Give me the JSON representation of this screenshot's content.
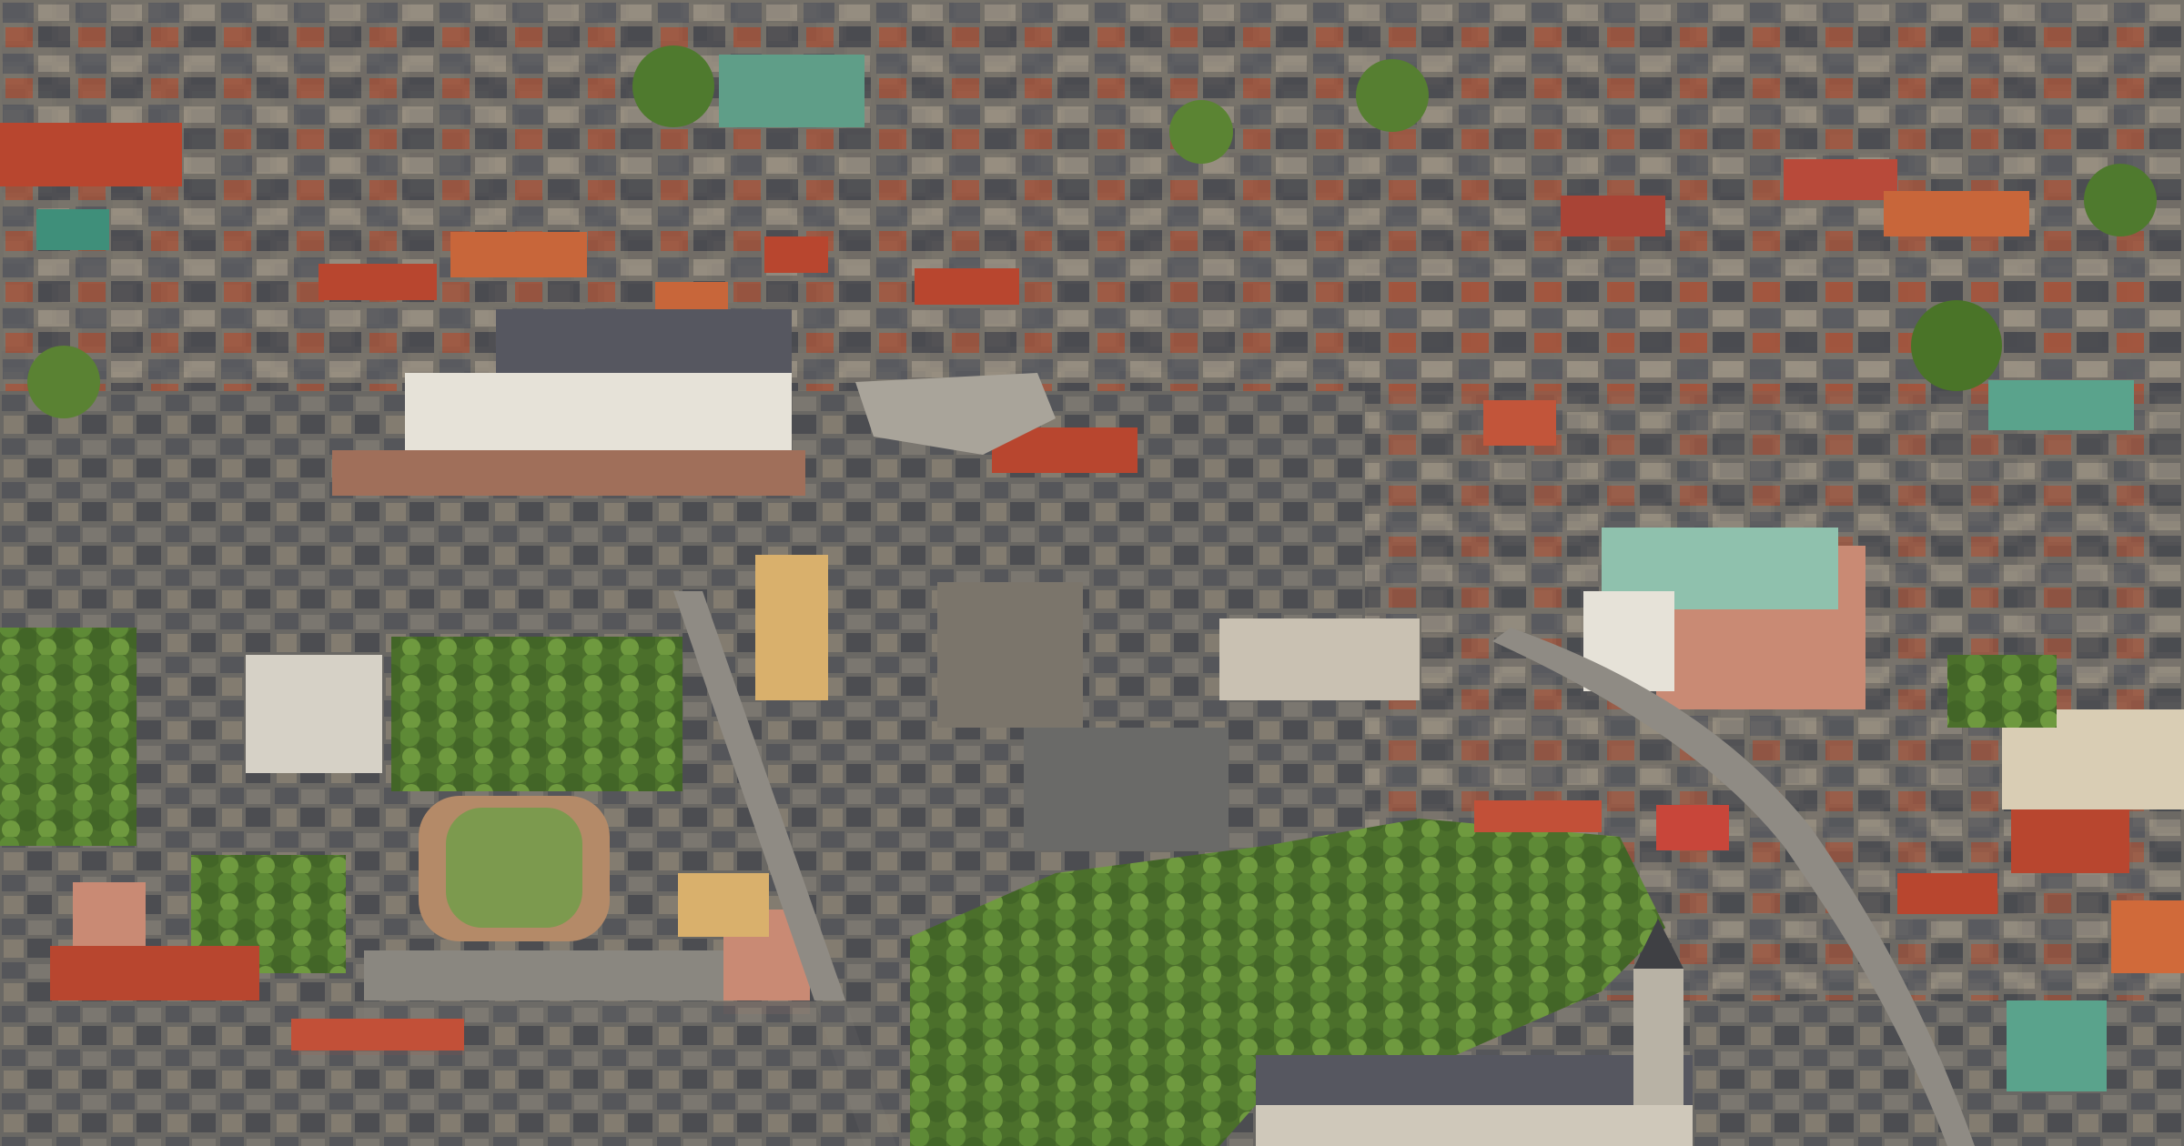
{
  "image": {
    "kind": "aerial-photograph",
    "palette": {
      "roof_grey": "#5e5f63",
      "roof_dark": "#3f4044",
      "roof_red": "#b8462f",
      "roof_orange": "#c8663a",
      "roof_green_copper": "#5f9e88",
      "facade_cream": "#d9cdb4",
      "facade_white": "#e6e2d8",
      "facade_pink": "#c98a74",
      "tree_green": "#4f7a2e",
      "tree_light": "#7d9b45",
      "field_green": "#7c9a4e",
      "track_clay": "#b48a68",
      "street": "#8f8b84"
    }
  }
}
